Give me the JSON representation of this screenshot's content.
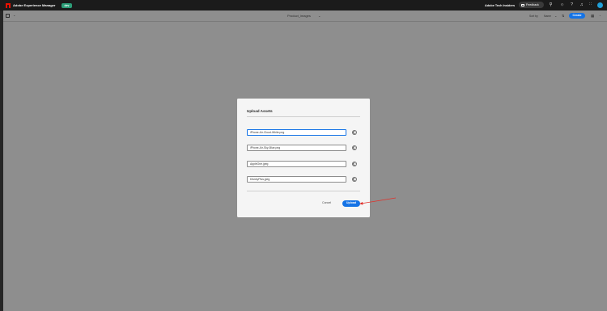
{
  "header": {
    "brand": "Adobe Experience Manager",
    "env_badge": "dev",
    "org": "Adobe Tech Insiders",
    "feedback_label": "Feedback"
  },
  "toolbar": {
    "folder_title": "Product_images",
    "sort_label": "Sort by",
    "sort_value": "Name",
    "create_label": "Create"
  },
  "dialog": {
    "title": "Upload Assets",
    "files": [
      {
        "name": "iPhone-Air-Cloud-White.png"
      },
      {
        "name": "iPhone-Air-Sky-Blue.png"
      },
      {
        "name": "AppleOne.jpeg"
      },
      {
        "name": "DisneyPlus.jpeg"
      }
    ],
    "cancel_label": "Cancel",
    "upload_label": "Upload"
  },
  "colors": {
    "accent": "#1473e6",
    "annotation_arrow": "#e0312b",
    "env_badge": "#2d9d78"
  }
}
